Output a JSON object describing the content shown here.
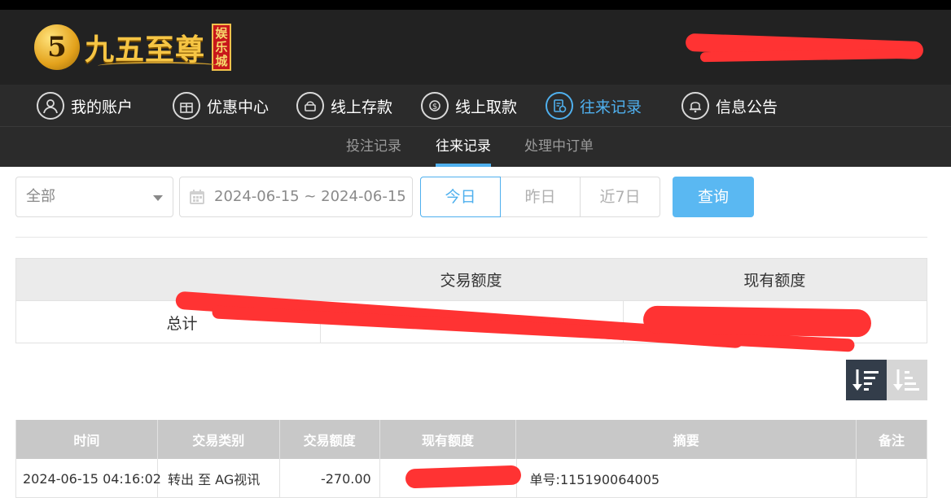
{
  "brand": {
    "logo_mark": "5",
    "name": "九五至尊",
    "badge_chars": [
      "娱",
      "乐",
      "城"
    ]
  },
  "colors": {
    "accent": "#4fb0ee",
    "header_bg": "#222222",
    "nav_bg": "#2b2b2b",
    "query_button": "#5ab8f2",
    "redaction": "#ff3333"
  },
  "nav": {
    "items": [
      {
        "label": "我的账户",
        "icon": "user-icon"
      },
      {
        "label": "优惠中心",
        "icon": "gift-icon"
      },
      {
        "label": "线上存款",
        "icon": "deposit-icon"
      },
      {
        "label": "线上取款",
        "icon": "withdraw-icon"
      },
      {
        "label": "往来记录",
        "icon": "records-icon",
        "active": true
      },
      {
        "label": "信息公告",
        "icon": "bell-icon"
      }
    ]
  },
  "subnav": {
    "tabs": [
      {
        "label": "投注记录"
      },
      {
        "label": "往来记录",
        "active": true
      },
      {
        "label": "处理中订单"
      }
    ]
  },
  "filters": {
    "type_select": "全部",
    "date_range": "2024-06-15 ~ 2024-06-15",
    "quick_ranges": [
      {
        "label": "今日",
        "active": true
      },
      {
        "label": "昨日"
      },
      {
        "label": "近7日"
      }
    ],
    "query_label": "查询"
  },
  "summary": {
    "headers": [
      "",
      "交易额度",
      "现有额度"
    ],
    "total_label": "总计"
  },
  "sort": {
    "desc_icon": "sort-descending-icon",
    "asc_icon": "sort-ascending-icon"
  },
  "records": {
    "headers": [
      "时间",
      "交易类别",
      "交易额度",
      "现有额度",
      "摘要",
      "备注"
    ],
    "rows": [
      {
        "time": "2024-06-15 04:16:02",
        "type": "转出 至 AG视讯",
        "amount": "-270.00",
        "balance": "",
        "summary": "单号:115190064005",
        "note": ""
      }
    ]
  }
}
